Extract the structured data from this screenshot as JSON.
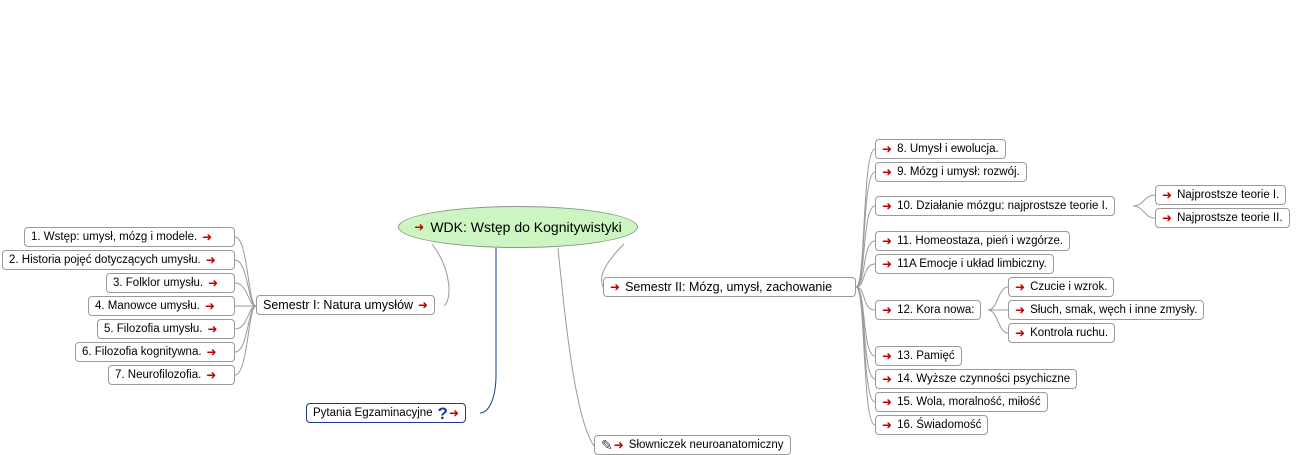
{
  "root": {
    "label": "WDK: Wstęp do Kognitywistyki",
    "arrow": "➜"
  },
  "left_branch": {
    "label": "Semestr I: Natura umysłów",
    "arrow": "➜",
    "children": [
      "1. Wstęp: umysł, mózg i modele.",
      "2. Historia pojęć dotyczących umysłu.",
      "3. Folklor umysłu.",
      "4. Manowce umysłu.",
      "5. Filozofia umysłu.",
      "6. Filozofia kognitywna.",
      "7. Neurofilozofia."
    ]
  },
  "pytania": {
    "label": "Pytania Egzaminacyjne",
    "icon": "question-icon",
    "arrow": "➜"
  },
  "slowniczek": {
    "label": "Słowniczek neuroanatomiczny",
    "icon": "document-icon",
    "arrow": "➜"
  },
  "right_branch": {
    "label": "Semestr II: Mózg, umysł, zachowanie",
    "arrow": "➜",
    "children": [
      {
        "label": "8. Umysł i ewolucja."
      },
      {
        "label": "9. Mózg i umysł: rozwój."
      },
      {
        "label": "10. Działanie mózgu: najprostsze teorie I.",
        "children": [
          "Najprostsze teorie I.",
          "Najprostsze teorie II."
        ]
      },
      {
        "label": "11. Homeostaza, pień i wzgórze."
      },
      {
        "label": "11A Emocje i układ limbiczny."
      },
      {
        "label": "12. Kora nowa:",
        "children": [
          "Czucie i wzrok.",
          "Słuch, smak, węch i inne zmysły.",
          "Kontrola ruchu."
        ]
      },
      {
        "label": "13. Pamięć"
      },
      {
        "label": "14. Wyższe czynności psychiczne"
      },
      {
        "label": "15. Wola, moralność, miłość"
      },
      {
        "label": "16. Świadomość"
      }
    ]
  },
  "colors": {
    "arrow": "#c00000",
    "root_fill": "#ccf5c2",
    "link": "#9a9a9a",
    "pytania_link": "#1d3b8f"
  }
}
